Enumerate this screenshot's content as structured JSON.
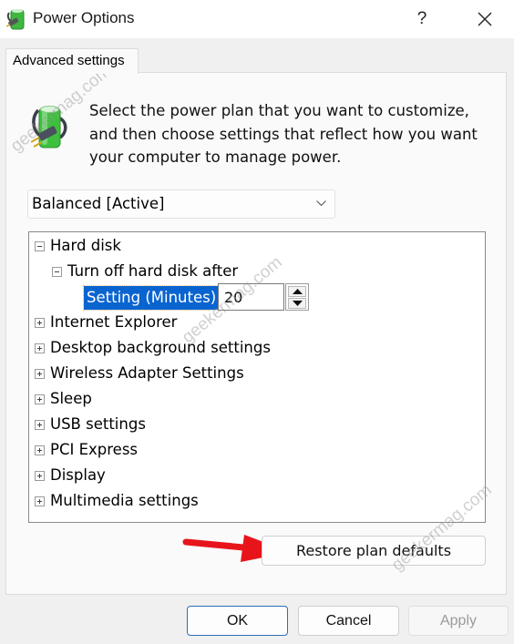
{
  "window": {
    "title": "Power Options",
    "help_label": "?",
    "icons": {
      "app": "power-plug-battery-icon",
      "close": "close-icon"
    }
  },
  "tabs": [
    {
      "label": "Advanced settings",
      "active": true
    }
  ],
  "description": "Select the power plan that you want to customize, and then choose settings that reflect how you want your computer to manage power.",
  "plan_select": {
    "value": "Balanced [Active]",
    "icon": "chevron-down-icon"
  },
  "tree": {
    "items": [
      {
        "label": "Hard disk",
        "expanded": true,
        "level": 0
      },
      {
        "label": "Turn off hard disk after",
        "expanded": true,
        "level": 1
      },
      {
        "label": "Internet Explorer",
        "expanded": false,
        "level": 0
      },
      {
        "label": "Desktop background settings",
        "expanded": false,
        "level": 0
      },
      {
        "label": "Wireless Adapter Settings",
        "expanded": false,
        "level": 0
      },
      {
        "label": "Sleep",
        "expanded": false,
        "level": 0
      },
      {
        "label": "USB settings",
        "expanded": false,
        "level": 0
      },
      {
        "label": "PCI Express",
        "expanded": false,
        "level": 0
      },
      {
        "label": "Display",
        "expanded": false,
        "level": 0
      },
      {
        "label": "Multimedia settings",
        "expanded": false,
        "level": 0
      }
    ],
    "setting": {
      "label": "Setting (Minutes):",
      "value": "20"
    }
  },
  "buttons": {
    "restore": "Restore plan defaults",
    "ok": "OK",
    "cancel": "Cancel",
    "apply": "Apply",
    "apply_enabled": false
  },
  "annotation": {
    "type": "arrow",
    "color": "#e8141b",
    "points_to": "restore-plan-defaults-button"
  },
  "watermark": "geekermag.com",
  "colors": {
    "selection": "#0a64d0",
    "ok_border": "#2d6eb6",
    "arrow": "#e8141b"
  }
}
